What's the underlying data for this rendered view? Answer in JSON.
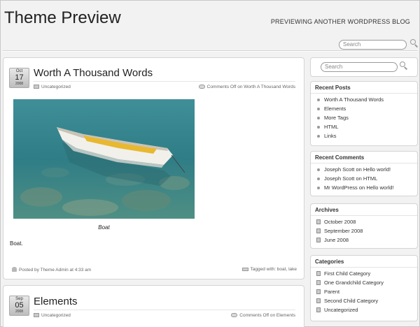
{
  "header": {
    "site_title": "Theme Preview",
    "site_description": "PREVIEWING ANOTHER WORDPRESS BLOG",
    "search_placeholder": "Search",
    "search_icon": "search-icon"
  },
  "posts": [
    {
      "date": {
        "month": "Oct",
        "day": "17",
        "year": "2008"
      },
      "title": "Worth A Thousand Words",
      "category": "Uncategorized",
      "comments": "Comments Off on Worth A Thousand Words",
      "image": "boat-photo",
      "caption": "Boat",
      "body": "Boat.",
      "posted_by": "Posted by Theme Admin at 4:33 am",
      "tags": "Tagged with: boat, lake"
    },
    {
      "date": {
        "month": "Sep",
        "day": "05",
        "year": "2008"
      },
      "title": "Elements",
      "category": "Uncategorized",
      "comments": "Comments Off on Elements"
    }
  ],
  "sidebar": {
    "search_placeholder": "Search",
    "recent_posts": {
      "title": "Recent Posts",
      "items": [
        "Worth A Thousand Words",
        "Elements",
        "More Tags",
        "HTML",
        "Links"
      ]
    },
    "recent_comments": {
      "title": "Recent Comments",
      "items": [
        {
          "author": "Joseph Scott",
          "on": "on",
          "post": "Hello world!"
        },
        {
          "author": "Joseph Scott",
          "on": "on",
          "post": "HTML"
        },
        {
          "author": "Mr WordPress",
          "on": "on",
          "post": "Hello world!"
        }
      ]
    },
    "archives": {
      "title": "Archives",
      "items": [
        "October 2008",
        "September 2008",
        "June 2008"
      ]
    },
    "categories": {
      "title": "Categories",
      "items": [
        "First Child Category",
        "One Grandchild Category",
        "Parent",
        "Second Child Category",
        "Uncategorized"
      ]
    }
  },
  "colors": {
    "background": "#f2f2f2",
    "panel": "#ffffff",
    "border": "#d4d4d4",
    "text": "#333333"
  }
}
